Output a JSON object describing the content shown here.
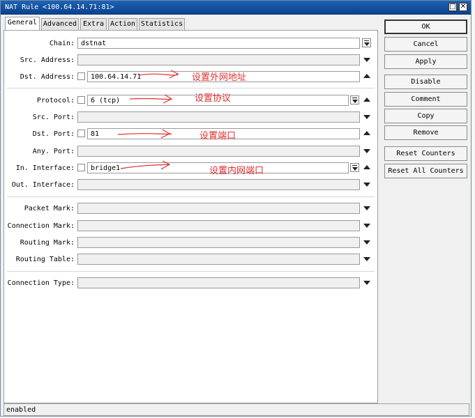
{
  "window": {
    "title": "NAT Rule <100.64.14.71:81>"
  },
  "tabs": [
    "General",
    "Advanced",
    "Extra",
    "Action",
    "Statistics"
  ],
  "fields": {
    "chain": {
      "label": "Chain:",
      "value": "dstnat"
    },
    "src_address": {
      "label": "Src. Address:"
    },
    "dst_address": {
      "label": "Dst. Address:",
      "value": "100.64.14.71",
      "note": "设置外网地址"
    },
    "protocol": {
      "label": "Protocol:",
      "value": "6 (tcp)",
      "note": "设置协议"
    },
    "src_port": {
      "label": "Src. Port:"
    },
    "dst_port": {
      "label": "Dst. Port:",
      "value": "81",
      "note": "设置端口"
    },
    "any_port": {
      "label": "Any. Port:"
    },
    "in_interface": {
      "label": "In. Interface:",
      "value": "bridge1",
      "note": "设置内网端口"
    },
    "out_interface": {
      "label": "Out. Interface:"
    },
    "packet_mark": {
      "label": "Packet Mark:"
    },
    "connection_mark": {
      "label": "Connection Mark:"
    },
    "routing_mark": {
      "label": "Routing Mark:"
    },
    "routing_table": {
      "label": "Routing Table:"
    },
    "connection_type": {
      "label": "Connection Type:"
    }
  },
  "buttons": {
    "ok": "OK",
    "cancel": "Cancel",
    "apply": "Apply",
    "disable": "Disable",
    "comment": "Comment",
    "copy": "Copy",
    "remove": "Remove",
    "reset_counters": "Reset Counters",
    "reset_all_counters": "Reset All Counters"
  },
  "status": {
    "text": "enabled"
  },
  "colors": {
    "annotation": "#e03030",
    "titlebar": "#1d63b8"
  }
}
